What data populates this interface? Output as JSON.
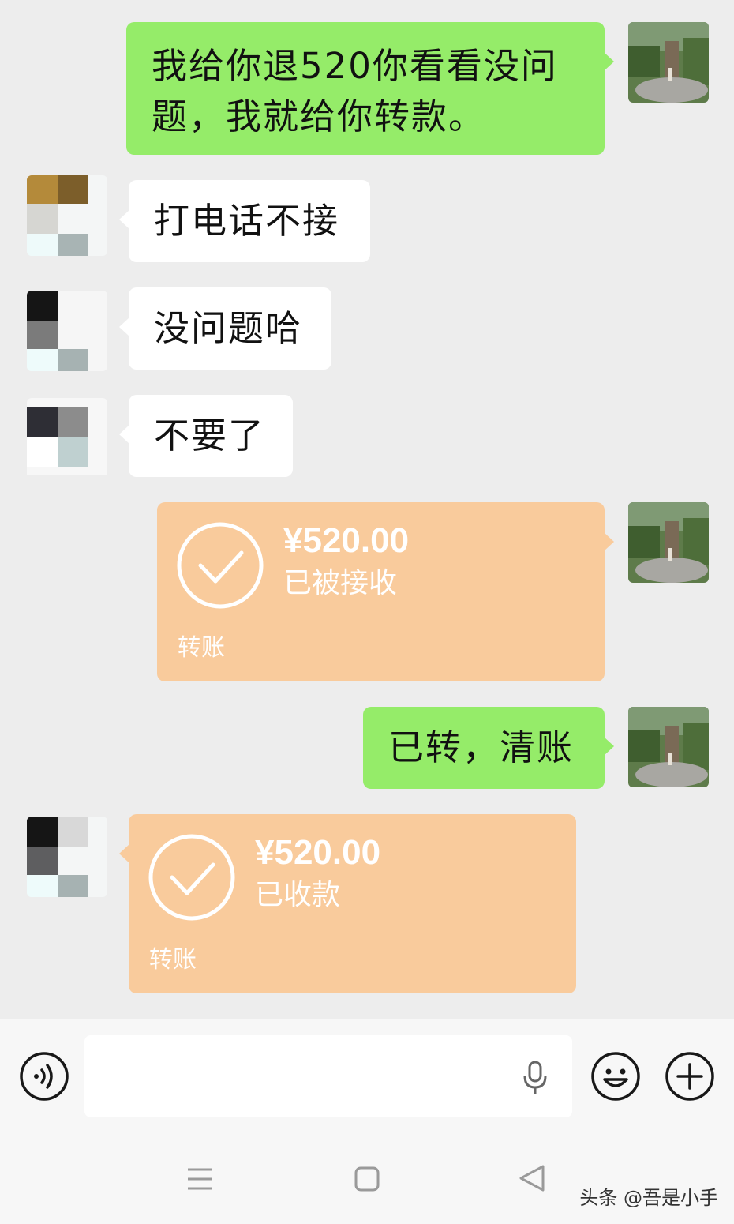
{
  "messages": [
    {
      "side": "right",
      "type": "text",
      "text": "我给你退520你看看没问\n题，我就给你转款。"
    },
    {
      "side": "left",
      "type": "text",
      "text": "打电话不接"
    },
    {
      "side": "left",
      "type": "text",
      "text": "没问题哈"
    },
    {
      "side": "left",
      "type": "text",
      "text": "不要了"
    },
    {
      "side": "right",
      "type": "transfer",
      "amount": "¥520.00",
      "status": "已被接收",
      "label": "转账"
    },
    {
      "side": "right",
      "type": "text",
      "text": "已转，清账"
    },
    {
      "side": "left",
      "type": "transfer",
      "amount": "¥520.00",
      "status": "已收款",
      "label": "转账"
    }
  ],
  "input": {
    "value": "",
    "placeholder": ""
  },
  "watermark": "头条 @吾是小手",
  "colors": {
    "chat_background": "#ededed",
    "sent_bubble": "#95ec69",
    "received_bubble": "#ffffff",
    "transfer_bubble": "#f9cb9c"
  }
}
